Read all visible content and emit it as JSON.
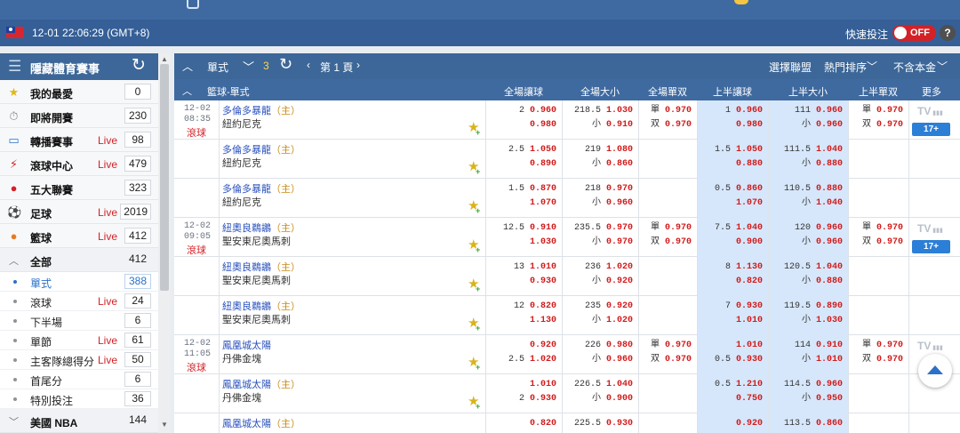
{
  "status": {
    "time": "12-01 22:06:29 (GMT+8)",
    "quick_bet_label": "快速投注",
    "toggle": "OFF",
    "help": "?"
  },
  "sidebar": {
    "title": "隱藏體育賽事",
    "items": [
      {
        "icon": "star-icon",
        "label": "我的最愛",
        "live": "",
        "count": "0"
      },
      {
        "icon": "stopwatch-icon",
        "label": "即將開賽",
        "live": "",
        "count": "230"
      },
      {
        "icon": "tv-icon",
        "label": "轉播賽事",
        "live": "Live",
        "count": "98"
      },
      {
        "icon": "running-icon",
        "label": "滾球中心",
        "live": "Live",
        "count": "479"
      },
      {
        "icon": "globe-ball-icon",
        "label": "五大聯賽",
        "live": "",
        "count": "323"
      },
      {
        "icon": "soccer-ball-icon",
        "label": "足球",
        "live": "Live",
        "count": "2019"
      },
      {
        "icon": "basketball-icon",
        "label": "籃球",
        "live": "Live",
        "count": "412"
      }
    ],
    "group_all": {
      "label": "全部",
      "count": "412"
    },
    "sub": [
      {
        "label": "單式",
        "live": "",
        "count": "388",
        "active": true
      },
      {
        "label": "滾球",
        "live": "Live",
        "count": "24"
      },
      {
        "label": "下半場",
        "live": "",
        "count": "6"
      },
      {
        "label": "單節",
        "live": "Live",
        "count": "61"
      },
      {
        "label": "主客隊總得分",
        "live": "Live",
        "count": "50"
      },
      {
        "label": "首尾分",
        "live": "",
        "count": "6"
      },
      {
        "label": "特別投注",
        "live": "",
        "count": "36"
      }
    ],
    "league": {
      "label": "美國 NBA",
      "count": "144"
    }
  },
  "toolbar": {
    "mode": "單式",
    "count": "3",
    "page": "第 1 頁",
    "select_league": "選擇聯盟",
    "sort": "熱門排序",
    "principal": "不含本金"
  },
  "columns": {
    "sport": "籃球-單式",
    "ft_hdp": "全場讓球",
    "ft_ou": "全場大小",
    "ft_oe": "全場單双",
    "h1_hdp": "上半讓球",
    "h1_ou": "上半大小",
    "h1_oe": "上半單双",
    "more": "更多"
  },
  "matches": [
    {
      "date": "12-02",
      "time": "08:35",
      "live": "滾球",
      "home": "多倫多暴龍",
      "home_tag": "（主）",
      "away": "紐約尼克",
      "hdp": [
        [
          "2",
          "0.960"
        ],
        [
          "",
          "0.980"
        ]
      ],
      "ou": [
        [
          "218.5",
          "1.030"
        ],
        [
          "小",
          "0.910"
        ]
      ],
      "oe": [
        [
          "單",
          "0.970"
        ],
        [
          "双",
          "0.970"
        ]
      ],
      "h_hdp": [
        [
          "1",
          "0.960"
        ],
        [
          "",
          "0.980"
        ]
      ],
      "h_ou": [
        [
          "111",
          "0.960"
        ],
        [
          "小",
          "0.960"
        ]
      ],
      "h_oe": [
        [
          "單",
          "0.970"
        ],
        [
          "双",
          "0.970"
        ]
      ],
      "tv": "TV",
      "more": "17+"
    },
    {
      "date": "",
      "time": "",
      "live": "",
      "home": "多倫多暴龍",
      "home_tag": "（主）",
      "away": "紐約尼克",
      "hdp": [
        [
          "2.5",
          "1.050"
        ],
        [
          "",
          "0.890"
        ]
      ],
      "ou": [
        [
          "219",
          "1.080"
        ],
        [
          "小",
          "0.860"
        ]
      ],
      "oe": [],
      "h_hdp": [
        [
          "1.5",
          "1.050"
        ],
        [
          "",
          "0.880"
        ]
      ],
      "h_ou": [
        [
          "111.5",
          "1.040"
        ],
        [
          "小",
          "0.880"
        ]
      ],
      "h_oe": [],
      "tv": "",
      "more": ""
    },
    {
      "date": "",
      "time": "",
      "live": "",
      "home": "多倫多暴龍",
      "home_tag": "（主）",
      "away": "紐約尼克",
      "hdp": [
        [
          "1.5",
          "0.870"
        ],
        [
          "",
          "1.070"
        ]
      ],
      "ou": [
        [
          "218",
          "0.970"
        ],
        [
          "小",
          "0.960"
        ]
      ],
      "oe": [],
      "h_hdp": [
        [
          "0.5",
          "0.860"
        ],
        [
          "",
          "1.070"
        ]
      ],
      "h_ou": [
        [
          "110.5",
          "0.880"
        ],
        [
          "小",
          "1.040"
        ]
      ],
      "h_oe": [],
      "tv": "",
      "more": ""
    },
    {
      "date": "12-02",
      "time": "09:05",
      "live": "滾球",
      "home": "紐奧良鵜鶘",
      "home_tag": "（主）",
      "away": "聖安東尼奧馬刺",
      "hdp": [
        [
          "12.5",
          "0.910"
        ],
        [
          "",
          "1.030"
        ]
      ],
      "ou": [
        [
          "235.5",
          "0.970"
        ],
        [
          "小",
          "0.970"
        ]
      ],
      "oe": [
        [
          "單",
          "0.970"
        ],
        [
          "双",
          "0.970"
        ]
      ],
      "h_hdp": [
        [
          "7.5",
          "1.040"
        ],
        [
          "",
          "0.900"
        ]
      ],
      "h_ou": [
        [
          "120",
          "0.960"
        ],
        [
          "小",
          "0.960"
        ]
      ],
      "h_oe": [
        [
          "單",
          "0.970"
        ],
        [
          "双",
          "0.970"
        ]
      ],
      "tv": "TV",
      "more": "17+"
    },
    {
      "date": "",
      "time": "",
      "live": "",
      "home": "紐奧良鵜鶘",
      "home_tag": "（主）",
      "away": "聖安東尼奧馬刺",
      "hdp": [
        [
          "13",
          "1.010"
        ],
        [
          "",
          "0.930"
        ]
      ],
      "ou": [
        [
          "236",
          "1.020"
        ],
        [
          "小",
          "0.920"
        ]
      ],
      "oe": [],
      "h_hdp": [
        [
          "8",
          "1.130"
        ],
        [
          "",
          "0.820"
        ]
      ],
      "h_ou": [
        [
          "120.5",
          "1.040"
        ],
        [
          "小",
          "0.880"
        ]
      ],
      "h_oe": [],
      "tv": "",
      "more": ""
    },
    {
      "date": "",
      "time": "",
      "live": "",
      "home": "紐奧良鵜鶘",
      "home_tag": "（主）",
      "away": "聖安東尼奧馬刺",
      "hdp": [
        [
          "12",
          "0.820"
        ],
        [
          "",
          "1.130"
        ]
      ],
      "ou": [
        [
          "235",
          "0.920"
        ],
        [
          "小",
          "1.020"
        ]
      ],
      "oe": [],
      "h_hdp": [
        [
          "7",
          "0.930"
        ],
        [
          "",
          "1.010"
        ]
      ],
      "h_ou": [
        [
          "119.5",
          "0.890"
        ],
        [
          "小",
          "1.030"
        ]
      ],
      "h_oe": [],
      "tv": "",
      "more": ""
    },
    {
      "date": "12-02",
      "time": "11:05",
      "live": "滾球",
      "home": "鳳凰城太陽",
      "home_tag": "",
      "away": "丹佛金塊",
      "hdp": [
        [
          "",
          "0.920"
        ],
        [
          "2.5",
          "1.020"
        ]
      ],
      "ou": [
        [
          "226",
          "0.980"
        ],
        [
          "小",
          "0.960"
        ]
      ],
      "oe": [
        [
          "單",
          "0.970"
        ],
        [
          "双",
          "0.970"
        ]
      ],
      "h_hdp": [
        [
          "",
          "1.010"
        ],
        [
          "0.5",
          "0.930"
        ]
      ],
      "h_ou": [
        [
          "114",
          "0.910"
        ],
        [
          "小",
          "1.010"
        ]
      ],
      "h_oe": [
        [
          "單",
          "0.970"
        ],
        [
          "双",
          "0.970"
        ]
      ],
      "tv": "TV",
      "more": ""
    },
    {
      "date": "",
      "time": "",
      "live": "",
      "home": "鳳凰城太陽",
      "home_tag": "（主）",
      "away": "丹佛金塊",
      "hdp": [
        [
          "",
          "1.010"
        ],
        [
          "2",
          "0.930"
        ]
      ],
      "ou": [
        [
          "226.5",
          "1.040"
        ],
        [
          "小",
          "0.900"
        ]
      ],
      "oe": [],
      "h_hdp": [
        [
          "0.5",
          "1.210"
        ],
        [
          "",
          "0.750"
        ]
      ],
      "h_ou": [
        [
          "114.5",
          "0.960"
        ],
        [
          "小",
          "0.950"
        ]
      ],
      "h_oe": [],
      "tv": "",
      "more": ""
    },
    {
      "date": "",
      "time": "",
      "live": "",
      "home": "鳳凰城太陽",
      "home_tag": "（主）",
      "away": "",
      "hdp": [
        [
          "",
          "0.820"
        ],
        [
          "",
          ""
        ]
      ],
      "ou": [
        [
          "225.5",
          "0.930"
        ],
        [
          "",
          ""
        ]
      ],
      "oe": [],
      "h_hdp": [
        [
          "",
          "0.920"
        ],
        [
          "",
          ""
        ]
      ],
      "h_ou": [
        [
          "113.5",
          "0.860"
        ],
        [
          "",
          ""
        ]
      ],
      "h_oe": [],
      "tv": "",
      "more": ""
    }
  ],
  "colors": {
    "header": "#3c6798",
    "odds": "#d11c1c",
    "live": "#d42126",
    "half_bg": "#d6e7fb",
    "accent": "#2b7fd6"
  }
}
